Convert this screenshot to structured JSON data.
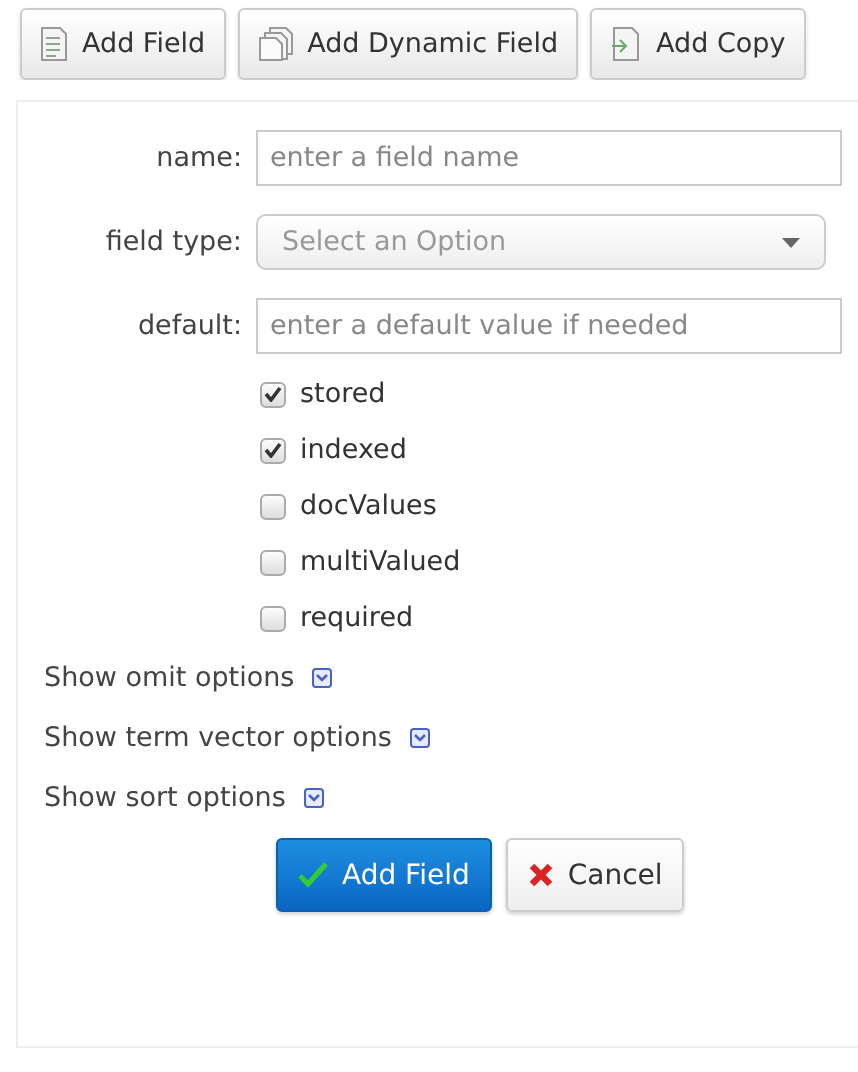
{
  "toolbar": [
    {
      "label": "Add Field",
      "kind": "field"
    },
    {
      "label": "Add Dynamic Field",
      "kind": "dynamic"
    },
    {
      "label": "Add Copy",
      "kind": "copy"
    }
  ],
  "form": {
    "fields": [
      {
        "label": "name:",
        "kind": "text",
        "placeholder": "enter a field name"
      },
      {
        "label": "field type:",
        "kind": "select",
        "placeholder": "Select an Option"
      },
      {
        "label": "default:",
        "kind": "text",
        "placeholder": "enter a default value if needed"
      }
    ],
    "checkboxes": [
      {
        "label": "stored",
        "checked": true
      },
      {
        "label": "indexed",
        "checked": true
      },
      {
        "label": "docValues",
        "checked": false
      },
      {
        "label": "multiValued",
        "checked": false
      },
      {
        "label": "required",
        "checked": false
      }
    ],
    "toggles": [
      {
        "label": "Show omit options",
        "expanded": false
      },
      {
        "label": "Show term vector options",
        "expanded": false
      },
      {
        "label": "Show sort options",
        "expanded": false
      }
    ],
    "actions": [
      {
        "label": "Add Field",
        "kind": "primary"
      },
      {
        "label": "Cancel",
        "kind": "cancel"
      }
    ]
  }
}
